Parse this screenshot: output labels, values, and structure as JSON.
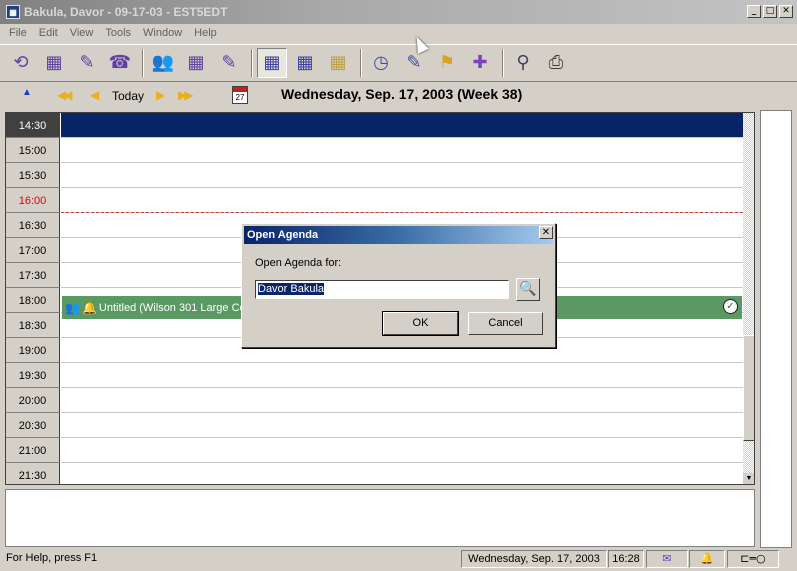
{
  "window": {
    "title": "Bakula, Davor - 09-17-03 - EST5EDT"
  },
  "menu": [
    "File",
    "Edit",
    "View",
    "Tools",
    "Window",
    "Help"
  ],
  "toolbar": {
    "buttons": [
      {
        "icon": "refresh-icon",
        "glyph": "⟲"
      },
      {
        "icon": "calendar-icon",
        "glyph": "▦"
      },
      {
        "icon": "task-icon",
        "glyph": "✎"
      },
      {
        "icon": "phone-icon",
        "glyph": "☎"
      },
      {
        "icon": "people-icon",
        "glyph": "👥"
      },
      {
        "icon": "group-calendar-icon",
        "glyph": "▦"
      },
      {
        "icon": "group-task-icon",
        "glyph": "✎"
      },
      {
        "icon": "day-view-icon",
        "glyph": "▦"
      },
      {
        "icon": "week-view-icon",
        "glyph": "▦"
      },
      {
        "icon": "month-view-icon",
        "glyph": "▦"
      },
      {
        "icon": "new-appointment-icon",
        "glyph": "◷"
      },
      {
        "icon": "new-task-icon",
        "glyph": "✎"
      },
      {
        "icon": "new-flag-icon",
        "glyph": "⚑"
      },
      {
        "icon": "new-pin-icon",
        "glyph": "✚"
      },
      {
        "icon": "find-icon",
        "glyph": "⚲"
      },
      {
        "icon": "print-icon",
        "glyph": "⎙"
      }
    ]
  },
  "nav": {
    "today_label": "Today",
    "date_header": "Wednesday, Sep. 17, 2003  (Week 38)",
    "calendar_day": "27"
  },
  "timeslots": [
    "14:30",
    "15:00",
    "15:30",
    "16:00",
    "16:30",
    "17:00",
    "17:30",
    "18:00",
    "18:30",
    "19:00",
    "19:30",
    "20:00",
    "20:30",
    "21:00",
    "21:30"
  ],
  "current_slot": "14:30",
  "now_slot": "16:00",
  "appointment": {
    "text": "Untitled (Wilson 301 Large Con"
  },
  "dialog": {
    "title": "Open Agenda",
    "label": "Open Agenda for:",
    "value": "Davor Bakula",
    "ok_label": "OK",
    "cancel_label": "Cancel"
  },
  "status": {
    "help": "For Help, press F1",
    "date": "Wednesday, Sep. 17, 2003",
    "time": "16:28"
  },
  "colors": {
    "selection": "#0a2468",
    "appointment": "#5a9a62",
    "now": "#e00000"
  }
}
